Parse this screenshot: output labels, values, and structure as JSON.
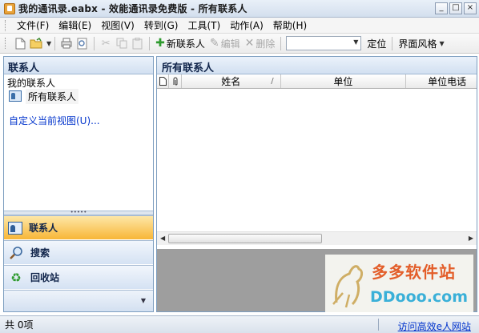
{
  "window": {
    "title": "我的通讯录.eabx - 效能通讯录免费版 - 所有联系人",
    "buttons": {
      "minimize": "_",
      "maximize": "□",
      "close": "×"
    }
  },
  "menu": {
    "items": [
      {
        "label": "文件(F)"
      },
      {
        "label": "编辑(E)"
      },
      {
        "label": "视图(V)"
      },
      {
        "label": "转到(G)"
      },
      {
        "label": "工具(T)"
      },
      {
        "label": "动作(A)"
      },
      {
        "label": "帮助(H)"
      }
    ]
  },
  "toolbar": {
    "new_contact": "新联系人",
    "edit": "编辑",
    "delete": "删除",
    "locate": "定位",
    "ui_style": "界面风格"
  },
  "left_panel": {
    "title": "联系人",
    "my_contacts": "我的联系人",
    "all_contacts_item": "所有联系人",
    "custom_view_link": "自定义当前视图(U)..."
  },
  "nav": {
    "contacts": "联系人",
    "search": "搜索",
    "recycle": "回收站"
  },
  "right_panel": {
    "title": "所有联系人",
    "columns": [
      "姓名",
      "单位",
      "单位电话"
    ]
  },
  "statusbar": {
    "count": "共 0项",
    "website_link": "访问高效e人网站"
  },
  "watermark": {
    "cn": "多多软件站",
    "en": "DDooo.com"
  },
  "colors": {
    "accent": "#f8b637",
    "panel_border": "#7d9ec0",
    "link": "#0033cc"
  }
}
